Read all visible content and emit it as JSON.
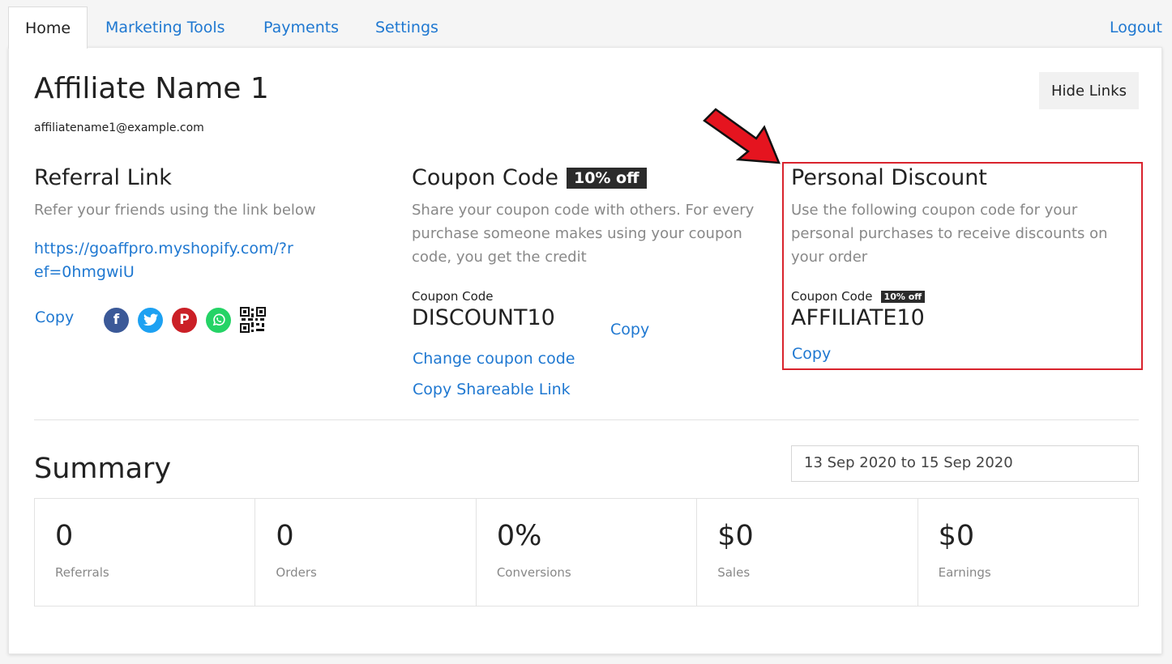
{
  "nav": {
    "tabs": [
      {
        "label": "Home",
        "active": true
      },
      {
        "label": "Marketing Tools"
      },
      {
        "label": "Payments"
      },
      {
        "label": "Settings"
      }
    ],
    "logout_label": "Logout"
  },
  "profile": {
    "name": "Affiliate Name 1",
    "email": "affiliatename1@example.com",
    "hide_links_label": "Hide Links"
  },
  "referral": {
    "title": "Referral Link",
    "description": "Refer your friends using the link below",
    "link": "https://goaffpro.myshopify.com/?ref=0hmgwiU",
    "copy_label": "Copy",
    "share_icons": [
      "facebook-icon",
      "twitter-icon",
      "pinterest-icon",
      "whatsapp-icon",
      "qr-code-icon"
    ]
  },
  "coupon": {
    "title": "Coupon Code",
    "badge": "10% off",
    "description": "Share your coupon code with others. For every purchase someone makes using your coupon code, you get the credit",
    "code_label": "Coupon Code",
    "code": "DISCOUNT10",
    "copy_label": "Copy",
    "change_label": "Change coupon code",
    "share_link_label": "Copy Shareable Link"
  },
  "personal_discount": {
    "title": "Personal Discount",
    "description": "Use the following coupon code for your personal purchases to receive discounts on your order",
    "code_label": "Coupon Code",
    "badge": "10% off",
    "code": "AFFILIATE10",
    "copy_label": "Copy",
    "highlight_color": "#d9232d"
  },
  "summary": {
    "title": "Summary",
    "date_range": "13 Sep 2020 to 15 Sep 2020",
    "stats": [
      {
        "value": "0",
        "label": "Referrals"
      },
      {
        "value": "0",
        "label": "Orders"
      },
      {
        "value": "0%",
        "label": "Conversions"
      },
      {
        "value": "$0",
        "label": "Sales"
      },
      {
        "value": "$0",
        "label": "Earnings"
      }
    ]
  },
  "colors": {
    "link": "#1f78d1",
    "badge_bg": "#2b2b2b",
    "annotation_red": "#e5141f"
  }
}
